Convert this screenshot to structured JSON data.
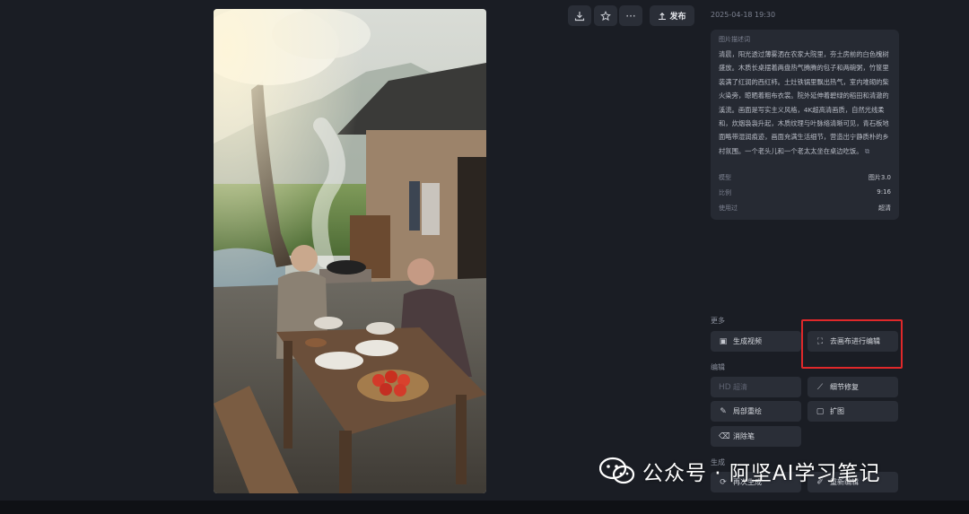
{
  "toolbar": {
    "download_icon": "download-icon",
    "favorite_icon": "star-icon",
    "more_icon": "more-icon",
    "publish_label": "发布"
  },
  "image": {
    "content": "elderly couple eating at outdoor wooden table"
  },
  "panel": {
    "timestamp": "2025-04-18 19:30",
    "description_label": "图片描述词",
    "description": "清晨，阳光透过薄雾洒在农家大院里，夯土房前的白色槐树盛放。木质长桌摆着两盘热气腾腾的包子和两碗粥，竹筐里装满了红润的西红柿。土灶铁锅里飘出热气，室内堆砌的柴火染旁，晾晒着粗布衣裳。院外延伸着碧绿的稻田和清澈的溪流。画面是写实主义风格，4K超高清画质，自然光线柔和，炊烟袅袅升起，木质纹理与叶脉络清晰可见，青石板地面略带湿润痕迹，画面充满生活细节，营造出宁静质朴的乡村氛围。一个老头儿和一个老太太坐在桌边吃饭。",
    "meta": [
      {
        "key": "模型",
        "value": "图片3.0"
      },
      {
        "key": "比例",
        "value": "9:16"
      },
      {
        "key": "使用过",
        "value": "超清"
      }
    ],
    "more_label": "更多",
    "more_buttons": [
      {
        "label": "生成视频",
        "icon": "video-icon"
      },
      {
        "label": "去画布进行编辑",
        "icon": "canvas-edit-icon"
      }
    ],
    "edit_label": "编辑",
    "edit_buttons": [
      {
        "label": "超清",
        "badge": "HD"
      },
      {
        "label": "细节修复"
      },
      {
        "label": "局部重绘"
      },
      {
        "label": "扩图"
      },
      {
        "label": "消除笔"
      }
    ],
    "generate_label": "生成",
    "generate_buttons": [
      {
        "label": "再次生成"
      },
      {
        "label": "重新编辑"
      }
    ]
  },
  "watermark": {
    "text": "公众号 · 阿坚AI学习笔记"
  },
  "colors": {
    "background": "#1a1d24",
    "card": "#262a33",
    "button": "#2a2e37",
    "highlight": "#e0282a"
  }
}
